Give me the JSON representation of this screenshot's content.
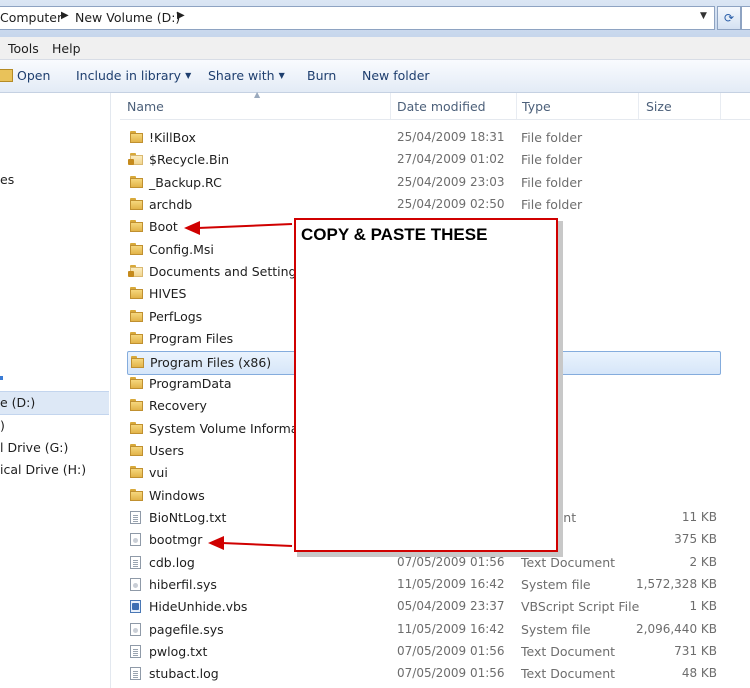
{
  "address": {
    "crumbs": [
      "Computer",
      "New Volume (D:)"
    ],
    "refresh_glyph": "⟳"
  },
  "menubar": [
    "Tools",
    "Help"
  ],
  "toolbar": {
    "open": "Open",
    "include": "Include in library",
    "share": "Share with",
    "burn": "Burn",
    "new_folder": "New folder"
  },
  "nav": {
    "items": [
      "es",
      "e (D:)",
      ")",
      "l Drive (G:)",
      "ical Drive (H:)"
    ]
  },
  "columns": {
    "name": "Name",
    "date": "Date modified",
    "type": "Type",
    "size": "Size"
  },
  "files": [
    {
      "name": "!KillBox",
      "date": "25/04/2009 18:31",
      "type": "File folder",
      "size": "",
      "icon": "folder-icon"
    },
    {
      "name": "$Recycle.Bin",
      "date": "27/04/2009 01:02",
      "type": "File folder",
      "size": "",
      "icon": "locked-folder-icon"
    },
    {
      "name": "_Backup.RC",
      "date": "25/04/2009 23:03",
      "type": "File folder",
      "size": "",
      "icon": "folder-icon"
    },
    {
      "name": "archdb",
      "date": "25/04/2009 02:50",
      "type": "File folder",
      "size": "",
      "icon": "folder-icon"
    },
    {
      "name": "Boot",
      "date": "",
      "type": "older",
      "size": "",
      "icon": "folder-icon"
    },
    {
      "name": "Config.Msi",
      "date": "",
      "type": "older",
      "size": "",
      "icon": "folder-icon"
    },
    {
      "name": "Documents and Settings",
      "date": "",
      "type": "older",
      "size": "",
      "icon": "locked-folder-icon"
    },
    {
      "name": "HIVES",
      "date": "",
      "type": "older",
      "size": "",
      "icon": "folder-icon"
    },
    {
      "name": "PerfLogs",
      "date": "",
      "type": "older",
      "size": "",
      "icon": "folder-icon"
    },
    {
      "name": "Program Files",
      "date": "",
      "type": "older",
      "size": "",
      "icon": "folder-icon"
    },
    {
      "name": "Program Files (x86)",
      "date": "",
      "type": "older",
      "size": "",
      "icon": "folder-icon",
      "selected": true
    },
    {
      "name": "ProgramData",
      "date": "",
      "type": "older",
      "size": "",
      "icon": "folder-icon"
    },
    {
      "name": "Recovery",
      "date": "",
      "type": "older",
      "size": "",
      "icon": "folder-icon"
    },
    {
      "name": "System Volume Informatio",
      "date": "",
      "type": "older",
      "size": "",
      "icon": "folder-icon"
    },
    {
      "name": "Users",
      "date": "",
      "type": "older",
      "size": "",
      "icon": "folder-icon"
    },
    {
      "name": "vui",
      "date": "",
      "type": "older",
      "size": "",
      "icon": "folder-icon"
    },
    {
      "name": "Windows",
      "date": "",
      "type": "older",
      "size": "",
      "icon": "folder-icon"
    },
    {
      "name": "BioNtLog.txt",
      "date": "",
      "type": "ocument",
      "size": "11 KB",
      "icon": "text-file-icon"
    },
    {
      "name": "bootmgr",
      "date": "",
      "type": "ile",
      "size": "375 KB",
      "icon": "system-file-icon"
    },
    {
      "name": "cdb.log",
      "date": "07/05/2009 01:56",
      "type": "Text Document",
      "size": "2 KB",
      "icon": "text-file-icon"
    },
    {
      "name": "hiberfil.sys",
      "date": "11/05/2009 16:42",
      "type": "System file",
      "size": "1,572,328 KB",
      "icon": "system-file-icon"
    },
    {
      "name": "HideUnhide.vbs",
      "date": "05/04/2009 23:37",
      "type": "VBScript Script File",
      "size": "1 KB",
      "icon": "vbscript-file-icon"
    },
    {
      "name": "pagefile.sys",
      "date": "11/05/2009 16:42",
      "type": "System file",
      "size": "2,096,440 KB",
      "icon": "system-file-icon"
    },
    {
      "name": "pwlog.txt",
      "date": "07/05/2009 01:56",
      "type": "Text Document",
      "size": "731 KB",
      "icon": "text-file-icon"
    },
    {
      "name": "stubact.log",
      "date": "07/05/2009 01:56",
      "type": "Text Document",
      "size": "48 KB",
      "icon": "text-file-icon"
    }
  ],
  "annotation": {
    "text": "COPY & PASTE THESE",
    "color": "#d00000"
  }
}
